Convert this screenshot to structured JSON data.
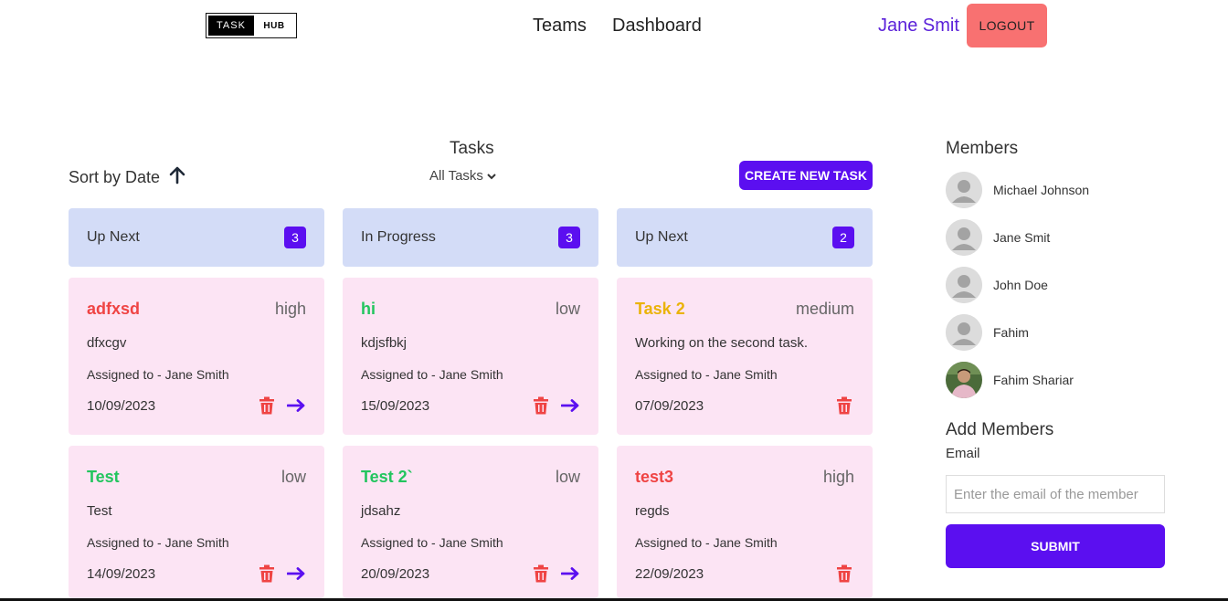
{
  "header": {
    "logo_left": "TASK",
    "logo_right": "HUB",
    "nav": [
      "Teams",
      "Dashboard"
    ],
    "user_name": "Jane Smit",
    "logout_label": "LOGOUT"
  },
  "tasks": {
    "title": "Tasks",
    "sort_label": "Sort by Date",
    "filter_label": "All Tasks",
    "create_label": "CREATE NEW TASK",
    "columns": [
      {
        "name": "Up Next",
        "count": "3"
      },
      {
        "name": "In Progress",
        "count": "3"
      },
      {
        "name": "Up Next",
        "count": "2"
      }
    ],
    "cards": [
      {
        "title": "adfxsd",
        "priority": "high",
        "desc": "dfxcgv",
        "assigned": "Assigned to - Jane Smith",
        "date": "10/09/2023"
      },
      {
        "title": "hi",
        "priority": "low",
        "desc": "kdjsfbkj",
        "assigned": "Assigned to - Jane Smith",
        "date": "15/09/2023"
      },
      {
        "title": "Task 2",
        "priority": "medium",
        "desc": "Working on the second task.",
        "assigned": "Assigned to - Jane Smith",
        "date": "07/09/2023"
      },
      {
        "title": "Test",
        "priority": "low",
        "desc": "Test",
        "assigned": "Assigned to - Jane Smith",
        "date": "14/09/2023"
      },
      {
        "title": "Test 2`",
        "priority": "low",
        "desc": "jdsahz",
        "assigned": "Assigned to - Jane Smith",
        "date": "20/09/2023"
      },
      {
        "title": "test3",
        "priority": "high",
        "desc": "regds",
        "assigned": "Assigned to - Jane Smith",
        "date": "22/09/2023"
      }
    ]
  },
  "members": {
    "title": "Members",
    "list": [
      "Michael Johnson",
      "Jane Smit",
      "John Doe",
      "Fahim",
      "Fahim Shariar"
    ],
    "add_title": "Add Members",
    "email_label": "Email",
    "email_placeholder": "Enter the email of the member",
    "submit_label": "SUBMIT"
  },
  "colors": {
    "accent": "#5b0ff0",
    "high": "#ef4444",
    "low": "#22c55e",
    "medium": "#eab308",
    "column_bg": "#d3dcf7",
    "card_bg": "#fce4f4"
  }
}
